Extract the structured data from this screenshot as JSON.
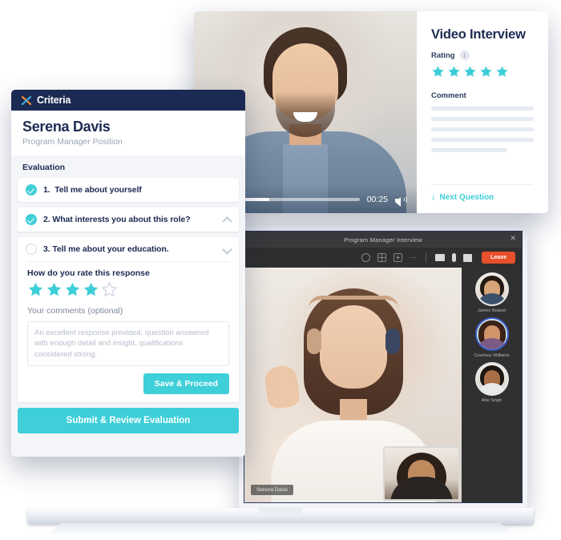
{
  "evaluation_panel": {
    "brand": "Criteria",
    "brand_icon": "criteria-x-logo",
    "candidate_name": "Serena Davis",
    "candidate_role": "Program Manager Position",
    "section_title": "Evaluation",
    "questions": [
      {
        "number": "1.",
        "text": "Tell me about yourself",
        "status": "complete",
        "chevron": "none"
      },
      {
        "number": "2.",
        "text": "What interests you about this role?",
        "status": "complete",
        "chevron": "up"
      },
      {
        "number": "3.",
        "text": "Tell me about your education.",
        "status": "incomplete",
        "chevron": "down"
      }
    ],
    "rating_label": "How do you rate this response",
    "rating_value": 4,
    "rating_max": 5,
    "comments_label": "Your comments",
    "comments_optional": " (optional)",
    "comments_placeholder": "An excellent response provided, question answered with enough detail and insight, qualifications considered strong.",
    "save_label": "Save & Proceed",
    "submit_label": "Submit & Review Evaluation"
  },
  "video_card": {
    "title": "Video Interview",
    "rating_label": "Rating",
    "info_icon": "info-icon",
    "rating_value": 5,
    "rating_max": 5,
    "comment_label": "Comment",
    "next_question_label": "Next Question",
    "next_question_icon": "arrow-down-icon",
    "player": {
      "play_icon": "play-icon",
      "timestamp": "00:25",
      "progress_percent": 35,
      "volume_icon": "volume-icon"
    }
  },
  "laptop": {
    "call_title": "Program Manager Interview",
    "close_icon": "close-icon",
    "toolbar_icons": [
      "chat-icon",
      "grid-view-icon",
      "add-person-icon",
      "more-options-icon",
      "camera-icon",
      "microphone-icon",
      "share-screen-icon"
    ],
    "leave_label": "Leave",
    "main_participant": "Serena Davis",
    "participants": [
      {
        "name": "James Noland",
        "active": false
      },
      {
        "name": "Courtney Williams",
        "active": true
      },
      {
        "name": "Abe Singh",
        "active": false
      }
    ]
  },
  "colors": {
    "accent_teal": "#3ecfd8",
    "navy": "#1b2a52",
    "leave_red": "#e8502b"
  }
}
